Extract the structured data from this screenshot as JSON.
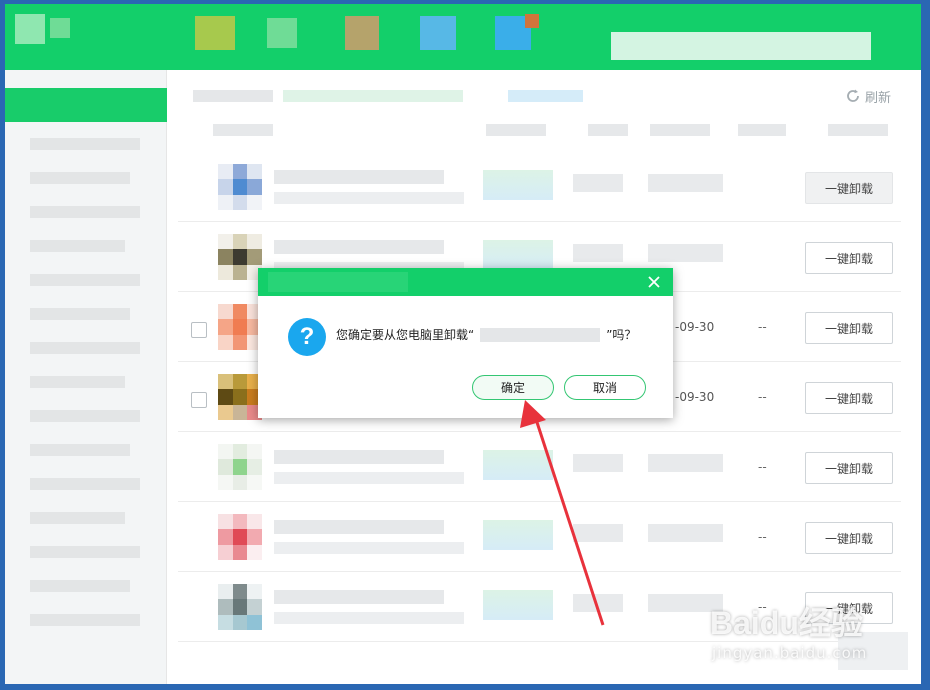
{
  "toolbar": {
    "refresh_label": "刷新",
    "refresh_icon": "refresh-icon"
  },
  "rows": [
    {
      "date": "",
      "freq": "",
      "button": "一键卸载",
      "checkbox": false
    },
    {
      "date": "",
      "freq": "",
      "button": "一键卸载",
      "checkbox": false
    },
    {
      "date": "-09-30",
      "freq": "--",
      "button": "一键卸载",
      "checkbox": true
    },
    {
      "date": "-09-30",
      "freq": "--",
      "button": "一键卸载",
      "checkbox": true
    },
    {
      "date": "",
      "freq": "--",
      "button": "一键卸载",
      "checkbox": false
    },
    {
      "date": "",
      "freq": "--",
      "button": "一键卸载",
      "checkbox": false
    },
    {
      "date": "",
      "freq": "--",
      "button": "一键卸载",
      "checkbox": false
    }
  ],
  "dialog": {
    "message_prefix": "您确定要从您电脑里卸载“",
    "message_suffix": "”吗？",
    "ok_label": "确定",
    "cancel_label": "取消",
    "close_icon": "close-icon",
    "question_icon": "question-icon"
  },
  "watermark": {
    "main": "Baidu经验",
    "sub": "jingyan.baidu.com"
  },
  "colors": {
    "brand_green": "#13cf6a",
    "question_blue": "#1aa7ee",
    "arrow_red": "#e8323c"
  }
}
